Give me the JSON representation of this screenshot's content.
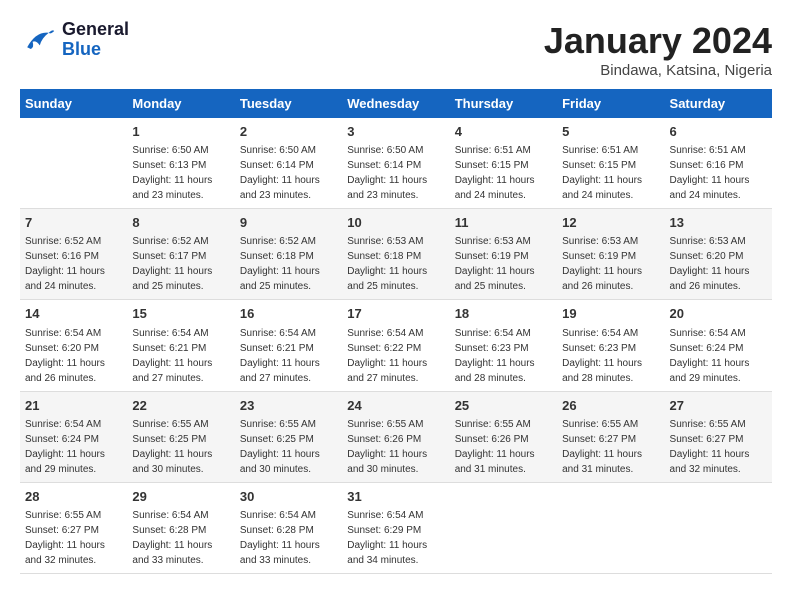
{
  "header": {
    "logo_line1": "General",
    "logo_line2": "Blue",
    "month": "January 2024",
    "location": "Bindawa, Katsina, Nigeria"
  },
  "weekdays": [
    "Sunday",
    "Monday",
    "Tuesday",
    "Wednesday",
    "Thursday",
    "Friday",
    "Saturday"
  ],
  "weeks": [
    [
      {
        "day": "",
        "sunrise": "",
        "sunset": "",
        "daylight": ""
      },
      {
        "day": "1",
        "sunrise": "Sunrise: 6:50 AM",
        "sunset": "Sunset: 6:13 PM",
        "daylight": "Daylight: 11 hours and 23 minutes."
      },
      {
        "day": "2",
        "sunrise": "Sunrise: 6:50 AM",
        "sunset": "Sunset: 6:14 PM",
        "daylight": "Daylight: 11 hours and 23 minutes."
      },
      {
        "day": "3",
        "sunrise": "Sunrise: 6:50 AM",
        "sunset": "Sunset: 6:14 PM",
        "daylight": "Daylight: 11 hours and 23 minutes."
      },
      {
        "day": "4",
        "sunrise": "Sunrise: 6:51 AM",
        "sunset": "Sunset: 6:15 PM",
        "daylight": "Daylight: 11 hours and 24 minutes."
      },
      {
        "day": "5",
        "sunrise": "Sunrise: 6:51 AM",
        "sunset": "Sunset: 6:15 PM",
        "daylight": "Daylight: 11 hours and 24 minutes."
      },
      {
        "day": "6",
        "sunrise": "Sunrise: 6:51 AM",
        "sunset": "Sunset: 6:16 PM",
        "daylight": "Daylight: 11 hours and 24 minutes."
      }
    ],
    [
      {
        "day": "7",
        "sunrise": "Sunrise: 6:52 AM",
        "sunset": "Sunset: 6:16 PM",
        "daylight": "Daylight: 11 hours and 24 minutes."
      },
      {
        "day": "8",
        "sunrise": "Sunrise: 6:52 AM",
        "sunset": "Sunset: 6:17 PM",
        "daylight": "Daylight: 11 hours and 25 minutes."
      },
      {
        "day": "9",
        "sunrise": "Sunrise: 6:52 AM",
        "sunset": "Sunset: 6:18 PM",
        "daylight": "Daylight: 11 hours and 25 minutes."
      },
      {
        "day": "10",
        "sunrise": "Sunrise: 6:53 AM",
        "sunset": "Sunset: 6:18 PM",
        "daylight": "Daylight: 11 hours and 25 minutes."
      },
      {
        "day": "11",
        "sunrise": "Sunrise: 6:53 AM",
        "sunset": "Sunset: 6:19 PM",
        "daylight": "Daylight: 11 hours and 25 minutes."
      },
      {
        "day": "12",
        "sunrise": "Sunrise: 6:53 AM",
        "sunset": "Sunset: 6:19 PM",
        "daylight": "Daylight: 11 hours and 26 minutes."
      },
      {
        "day": "13",
        "sunrise": "Sunrise: 6:53 AM",
        "sunset": "Sunset: 6:20 PM",
        "daylight": "Daylight: 11 hours and 26 minutes."
      }
    ],
    [
      {
        "day": "14",
        "sunrise": "Sunrise: 6:54 AM",
        "sunset": "Sunset: 6:20 PM",
        "daylight": "Daylight: 11 hours and 26 minutes."
      },
      {
        "day": "15",
        "sunrise": "Sunrise: 6:54 AM",
        "sunset": "Sunset: 6:21 PM",
        "daylight": "Daylight: 11 hours and 27 minutes."
      },
      {
        "day": "16",
        "sunrise": "Sunrise: 6:54 AM",
        "sunset": "Sunset: 6:21 PM",
        "daylight": "Daylight: 11 hours and 27 minutes."
      },
      {
        "day": "17",
        "sunrise": "Sunrise: 6:54 AM",
        "sunset": "Sunset: 6:22 PM",
        "daylight": "Daylight: 11 hours and 27 minutes."
      },
      {
        "day": "18",
        "sunrise": "Sunrise: 6:54 AM",
        "sunset": "Sunset: 6:23 PM",
        "daylight": "Daylight: 11 hours and 28 minutes."
      },
      {
        "day": "19",
        "sunrise": "Sunrise: 6:54 AM",
        "sunset": "Sunset: 6:23 PM",
        "daylight": "Daylight: 11 hours and 28 minutes."
      },
      {
        "day": "20",
        "sunrise": "Sunrise: 6:54 AM",
        "sunset": "Sunset: 6:24 PM",
        "daylight": "Daylight: 11 hours and 29 minutes."
      }
    ],
    [
      {
        "day": "21",
        "sunrise": "Sunrise: 6:54 AM",
        "sunset": "Sunset: 6:24 PM",
        "daylight": "Daylight: 11 hours and 29 minutes."
      },
      {
        "day": "22",
        "sunrise": "Sunrise: 6:55 AM",
        "sunset": "Sunset: 6:25 PM",
        "daylight": "Daylight: 11 hours and 30 minutes."
      },
      {
        "day": "23",
        "sunrise": "Sunrise: 6:55 AM",
        "sunset": "Sunset: 6:25 PM",
        "daylight": "Daylight: 11 hours and 30 minutes."
      },
      {
        "day": "24",
        "sunrise": "Sunrise: 6:55 AM",
        "sunset": "Sunset: 6:26 PM",
        "daylight": "Daylight: 11 hours and 30 minutes."
      },
      {
        "day": "25",
        "sunrise": "Sunrise: 6:55 AM",
        "sunset": "Sunset: 6:26 PM",
        "daylight": "Daylight: 11 hours and 31 minutes."
      },
      {
        "day": "26",
        "sunrise": "Sunrise: 6:55 AM",
        "sunset": "Sunset: 6:27 PM",
        "daylight": "Daylight: 11 hours and 31 minutes."
      },
      {
        "day": "27",
        "sunrise": "Sunrise: 6:55 AM",
        "sunset": "Sunset: 6:27 PM",
        "daylight": "Daylight: 11 hours and 32 minutes."
      }
    ],
    [
      {
        "day": "28",
        "sunrise": "Sunrise: 6:55 AM",
        "sunset": "Sunset: 6:27 PM",
        "daylight": "Daylight: 11 hours and 32 minutes."
      },
      {
        "day": "29",
        "sunrise": "Sunrise: 6:54 AM",
        "sunset": "Sunset: 6:28 PM",
        "daylight": "Daylight: 11 hours and 33 minutes."
      },
      {
        "day": "30",
        "sunrise": "Sunrise: 6:54 AM",
        "sunset": "Sunset: 6:28 PM",
        "daylight": "Daylight: 11 hours and 33 minutes."
      },
      {
        "day": "31",
        "sunrise": "Sunrise: 6:54 AM",
        "sunset": "Sunset: 6:29 PM",
        "daylight": "Daylight: 11 hours and 34 minutes."
      },
      {
        "day": "",
        "sunrise": "",
        "sunset": "",
        "daylight": ""
      },
      {
        "day": "",
        "sunrise": "",
        "sunset": "",
        "daylight": ""
      },
      {
        "day": "",
        "sunrise": "",
        "sunset": "",
        "daylight": ""
      }
    ]
  ]
}
